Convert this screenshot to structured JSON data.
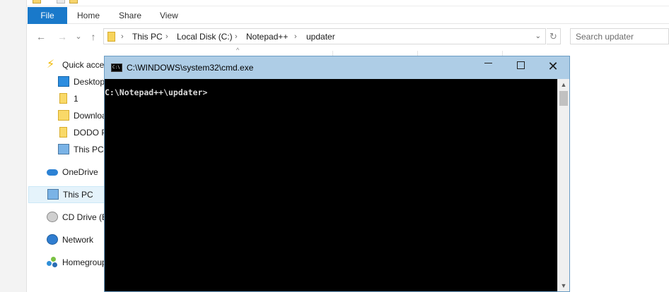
{
  "ribbon": {
    "tabs": [
      "File",
      "Home",
      "Share",
      "View"
    ]
  },
  "address": {
    "crumbs": [
      "This PC",
      "Local Disk (C:)",
      "Notepad++",
      "updater"
    ],
    "separator": "›",
    "dropdown": "⌄",
    "refresh": "↻"
  },
  "nav_buttons": {
    "back": "←",
    "forward": "→",
    "recent": "⌄",
    "up": "↑"
  },
  "search": {
    "placeholder": "Search updater"
  },
  "sort_indicator": "^",
  "sidebar": {
    "items": [
      {
        "label": "Quick acces",
        "icon": "quick-access-star-icon"
      },
      {
        "label": "Desktop",
        "icon": "desktop-icon"
      },
      {
        "label": "1",
        "icon": "folder-icon"
      },
      {
        "label": "Downloa",
        "icon": "downloads-icon"
      },
      {
        "label": "DODO P",
        "icon": "folder-icon"
      },
      {
        "label": "This PC",
        "icon": "this-pc-icon"
      },
      {
        "label": "OneDrive",
        "icon": "onedrive-icon"
      },
      {
        "label": "This PC",
        "icon": "this-pc-icon"
      },
      {
        "label": "CD Drive (E",
        "icon": "cd-drive-icon"
      },
      {
        "label": "Network",
        "icon": "network-icon"
      },
      {
        "label": "Homegroup",
        "icon": "homegroup-icon"
      }
    ]
  },
  "cmd": {
    "title": "C:\\WINDOWS\\system32\\cmd.exe",
    "prompt": "C:\\Notepad++\\updater>",
    "controls": {
      "minimize": "",
      "maximize": "",
      "close": "✕"
    },
    "scroll_up": "▲",
    "scroll_down": "▼"
  },
  "colors": {
    "file_tab": "#1979ca",
    "cmd_titlebar": "#aecde6",
    "console_bg": "#000000",
    "console_text": "#d9d9d9"
  }
}
